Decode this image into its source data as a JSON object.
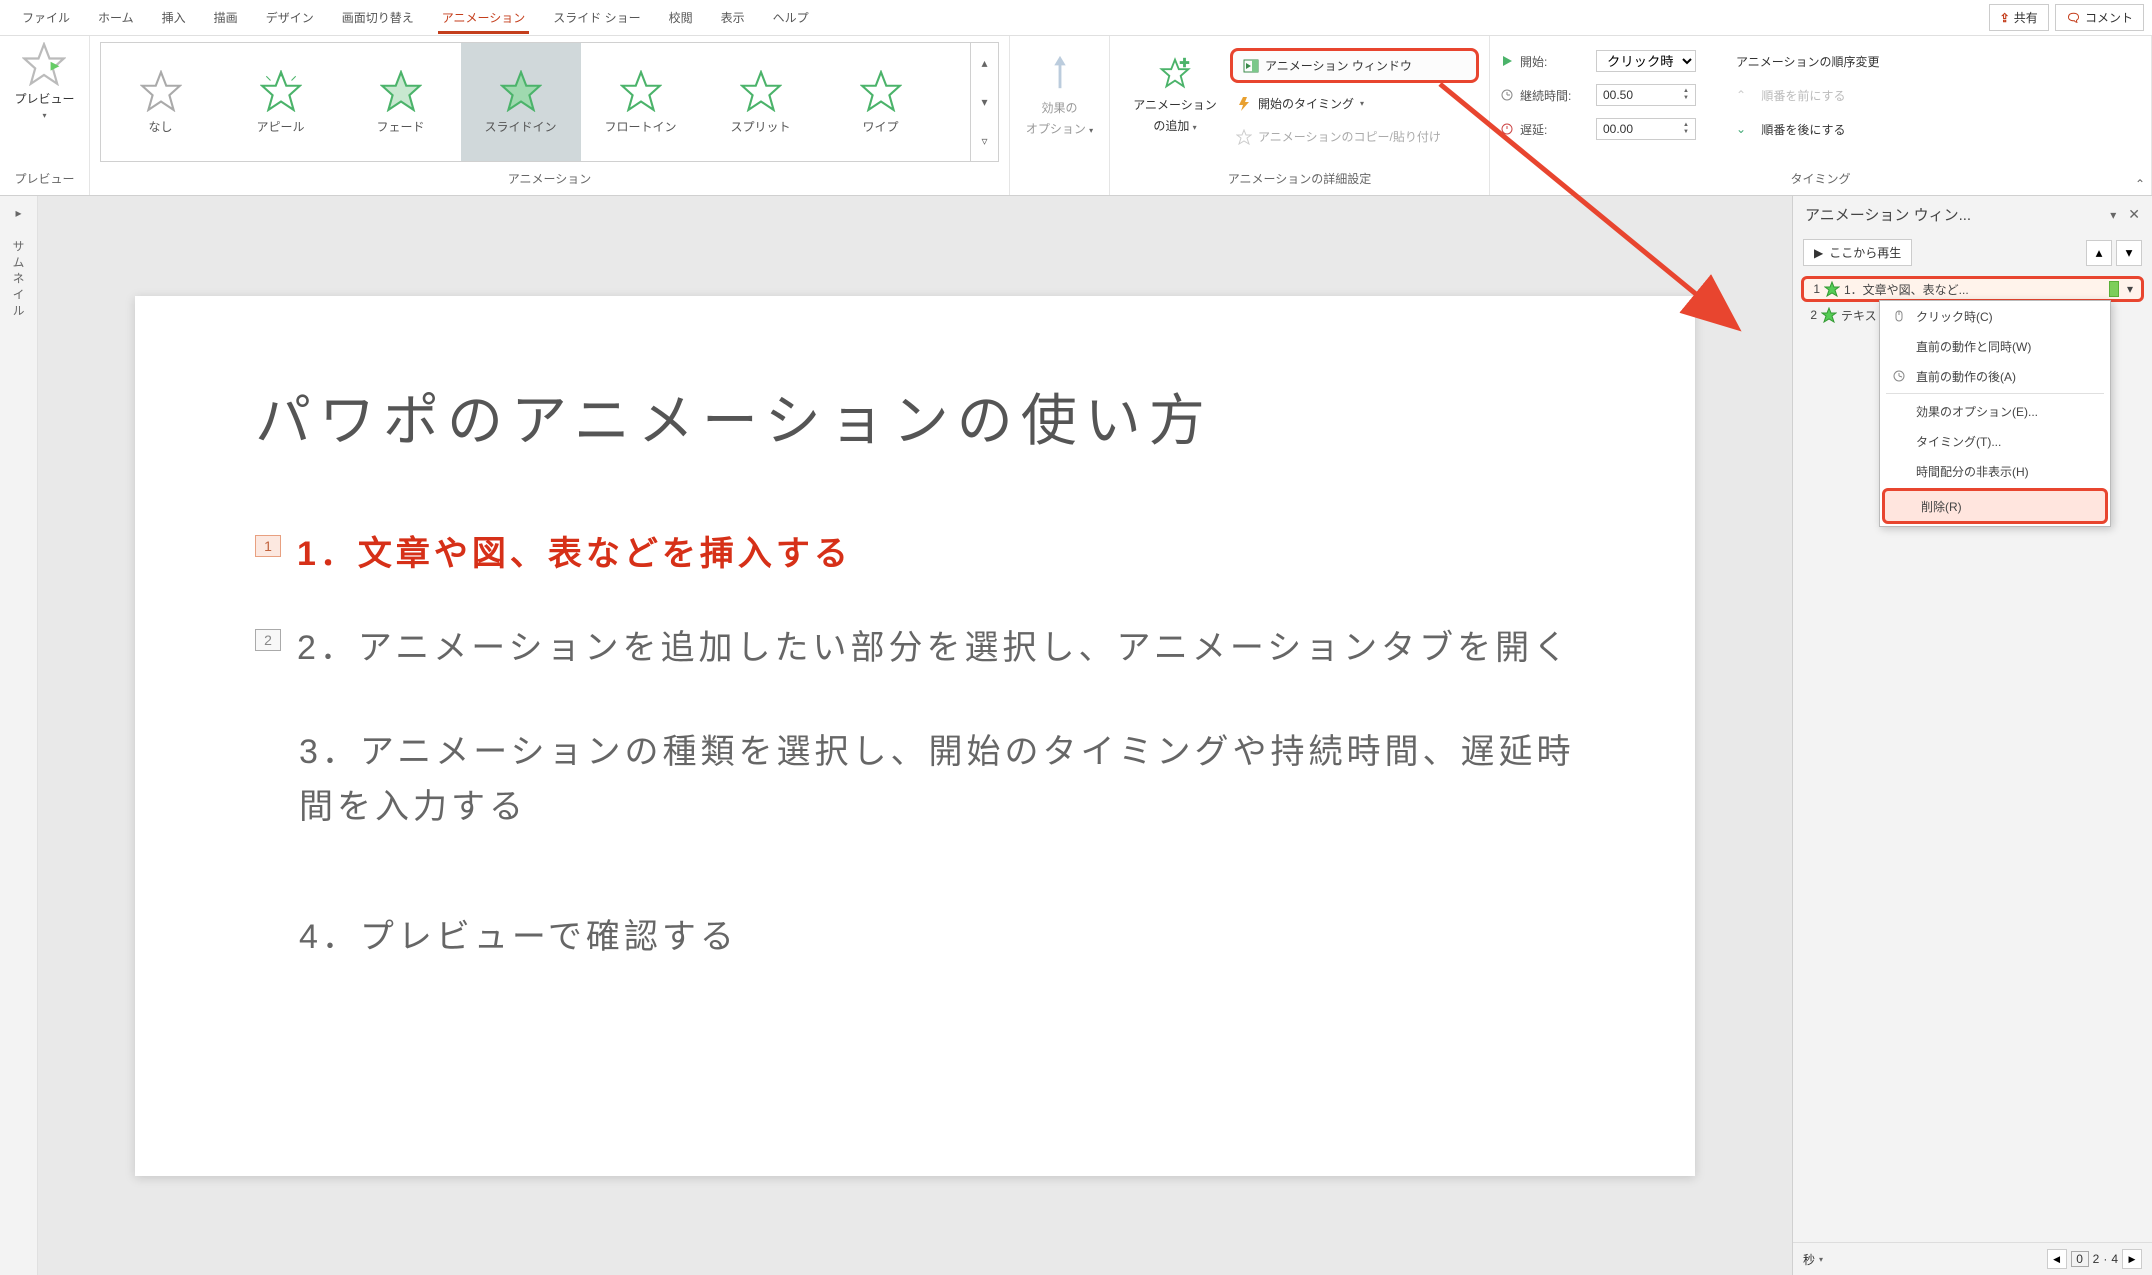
{
  "tabs": {
    "file": "ファイル",
    "home": "ホーム",
    "insert": "挿入",
    "draw": "描画",
    "design": "デザイン",
    "transitions": "画面切り替え",
    "animations": "アニメーション",
    "slideshow": "スライド ショー",
    "review": "校閲",
    "view": "表示",
    "help": "ヘルプ"
  },
  "top_actions": {
    "share": "共有",
    "comment": "コメント"
  },
  "ribbon": {
    "preview": {
      "label": "プレビュー",
      "button": "プレビュー"
    },
    "gallery": {
      "group_label": "アニメーション",
      "items": [
        "なし",
        "アピール",
        "フェード",
        "スライドイン",
        "フロートイン",
        "スプリット",
        "ワイプ"
      ]
    },
    "effect_options": {
      "line1": "効果の",
      "line2": "オプション"
    },
    "advanced": {
      "add_line1": "アニメーション",
      "add_line2": "の追加",
      "pane_button": "アニメーション ウィンドウ",
      "trigger": "開始のタイミング",
      "painter": "アニメーションのコピー/貼り付け",
      "group_label": "アニメーションの詳細設定"
    },
    "timing": {
      "start_label": "開始:",
      "start_value": "クリック時",
      "duration_label": "継続時間:",
      "duration_value": "00.50",
      "delay_label": "遅延:",
      "delay_value": "00.00",
      "reorder_label": "アニメーションの順序変更",
      "move_earlier": "順番を前にする",
      "move_later": "順番を後にする",
      "group_label": "タイミング"
    }
  },
  "thumbnail_label": "サムネイル",
  "slide": {
    "title": "パワポのアニメーションの使い方",
    "items": [
      {
        "num": "1",
        "text": "1．文章や図、表などを挿入する",
        "highlighted": true
      },
      {
        "num": "2",
        "text": "2．アニメーションを追加したい部分を選択し、アニメーションタブを開く"
      },
      {
        "num": "",
        "text": "3．アニメーションの種類を選択し、開始のタイミングや持続時間、遅延時間を入力する"
      },
      {
        "num": "",
        "text": "4．プレビューで確認する"
      }
    ]
  },
  "anim_pane": {
    "title": "アニメーション ウィン...",
    "play": "ここから再生",
    "items": [
      {
        "idx": "1",
        "name": "1．文章や図、表など..."
      },
      {
        "idx": "2",
        "name": "テキスト"
      }
    ],
    "footer_seconds": "秒",
    "footer_nav": {
      "cur": "0",
      "p2": "2",
      "p4": "4"
    }
  },
  "context_menu": {
    "on_click": "クリック時(C)",
    "with_prev": "直前の動作と同時(W)",
    "after_prev": "直前の動作の後(A)",
    "effect_opts": "効果のオプション(E)...",
    "timing": "タイミング(T)...",
    "hide_timeline": "時間配分の非表示(H)",
    "remove": "削除(R)"
  }
}
